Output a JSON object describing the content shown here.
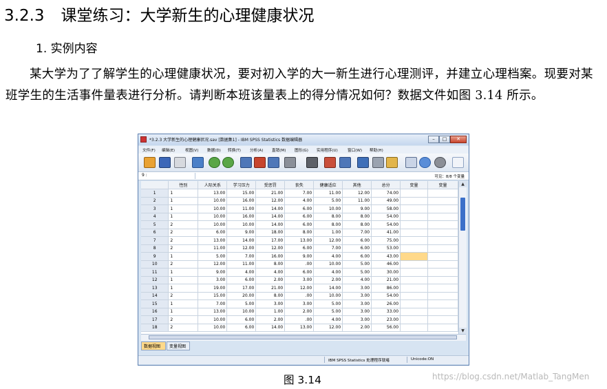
{
  "doc": {
    "section_number": "3.2.3",
    "section_title": "课堂练习：大学新生的心理健康状况",
    "subheading": "1. 实例内容",
    "paragraph": "某大学为了了解学生的心理健康状况，要对初入学的大一新生进行心理测评，并建立心理档案。现要对某班学生的生活事件量表进行分析。请判断本班该量表上的得分情况如何？数据文件如图 3.14 所示。",
    "figure_caption": "图 3.14",
    "watermark": "https://blog.csdn.net/Matlab_TangMen"
  },
  "spss": {
    "window_title": "*3.2.3 大学新生的心理健康状况.sav [数据集1] - IBM SPSS Statistics 数据编辑器",
    "window_buttons": [
      "–",
      "□",
      "✕"
    ],
    "menu": [
      "文件(F)",
      "编辑(E)",
      "视图(V)",
      "数据(D)",
      "转换(T)",
      "分析(A)",
      "直销(M)",
      "图形(G)",
      "实用程序(U)",
      "窗口(W)",
      "帮助(H)"
    ],
    "toolbar_icons": [
      "open-folder-icon",
      "save-icon",
      "print-icon",
      "dialog-recall-icon",
      "undo-icon",
      "redo-icon",
      "goto-case-icon",
      "goto-variable-icon",
      "variables-icon",
      "run-descriptives-icon",
      "find-icon",
      "insert-cases-icon",
      "insert-variable-icon",
      "split-file-icon",
      "weight-cases-icon",
      "select-cases-icon",
      "value-labels-icon",
      "use-sets-icon",
      "show-all-variables-icon",
      "spell-check-icon"
    ],
    "cell_ref": "9 :",
    "visible_vars": "可见：8/8 个变量",
    "columns": [
      "",
      "性别",
      "人际关系",
      "学习压力",
      "受惩罚",
      "丧失",
      "健康适应",
      "其他",
      "总分",
      "变量",
      "变量"
    ],
    "rows": [
      [
        "1",
        "1",
        "13.00",
        "15.00",
        "21.00",
        "7.00",
        "11.00",
        "12.00",
        "74.00"
      ],
      [
        "2",
        "1",
        "10.00",
        "16.00",
        "12.00",
        "4.00",
        "5.00",
        "11.00",
        "49.00"
      ],
      [
        "3",
        "1",
        "10.00",
        "11.00",
        "14.00",
        "6.00",
        "10.00",
        "9.00",
        "58.00"
      ],
      [
        "4",
        "1",
        "10.00",
        "16.00",
        "14.00",
        "6.00",
        "8.00",
        "8.00",
        "54.00"
      ],
      [
        "5",
        "2",
        "10.00",
        "10.00",
        "14.00",
        "6.00",
        "8.00",
        "8.00",
        "54.00"
      ],
      [
        "6",
        "2",
        "6.00",
        "9.00",
        "18.00",
        "8.00",
        "1.00",
        "7.00",
        "41.00"
      ],
      [
        "7",
        "2",
        "13.00",
        "14.00",
        "17.00",
        "13.00",
        "12.00",
        "6.00",
        "75.00"
      ],
      [
        "8",
        "2",
        "11.00",
        "12.00",
        "12.00",
        "6.00",
        "7.00",
        "6.00",
        "53.00"
      ],
      [
        "9",
        "1",
        "5.00",
        "7.00",
        "16.00",
        "9.00",
        "4.00",
        "6.00",
        "43.00"
      ],
      [
        "10",
        "2",
        "12.00",
        "11.00",
        "8.00",
        ".00",
        "10.00",
        "5.00",
        "46.00"
      ],
      [
        "11",
        "1",
        "9.00",
        "4.00",
        "4.00",
        "6.00",
        "4.00",
        "5.00",
        "30.00"
      ],
      [
        "12",
        "1",
        "3.00",
        "6.00",
        "2.00",
        "3.00",
        "2.00",
        "4.00",
        "21.00"
      ],
      [
        "13",
        "1",
        "19.00",
        "17.00",
        "21.00",
        "12.00",
        "14.00",
        "3.00",
        "86.00"
      ],
      [
        "14",
        "2",
        "15.00",
        "20.00",
        "8.00",
        ".00",
        "10.00",
        "3.00",
        "54.00"
      ],
      [
        "15",
        "1",
        "7.00",
        "5.00",
        "3.00",
        "3.00",
        "5.00",
        "3.00",
        "26.00"
      ],
      [
        "16",
        "1",
        "13.00",
        "10.00",
        "1.00",
        "2.00",
        "5.00",
        "3.00",
        "33.00"
      ],
      [
        "17",
        "2",
        "10.00",
        "6.00",
        "2.00",
        ".00",
        "4.00",
        "3.00",
        "23.00"
      ],
      [
        "18",
        "2",
        "10.00",
        "6.00",
        "14.00",
        "13.00",
        "12.00",
        "2.00",
        "56.00"
      ]
    ],
    "view_tabs": [
      "数据视图",
      "变量视图"
    ],
    "status_processor": "IBM SPSS Statistics 处理程序就绪",
    "status_unicode": "Unicode:ON"
  }
}
